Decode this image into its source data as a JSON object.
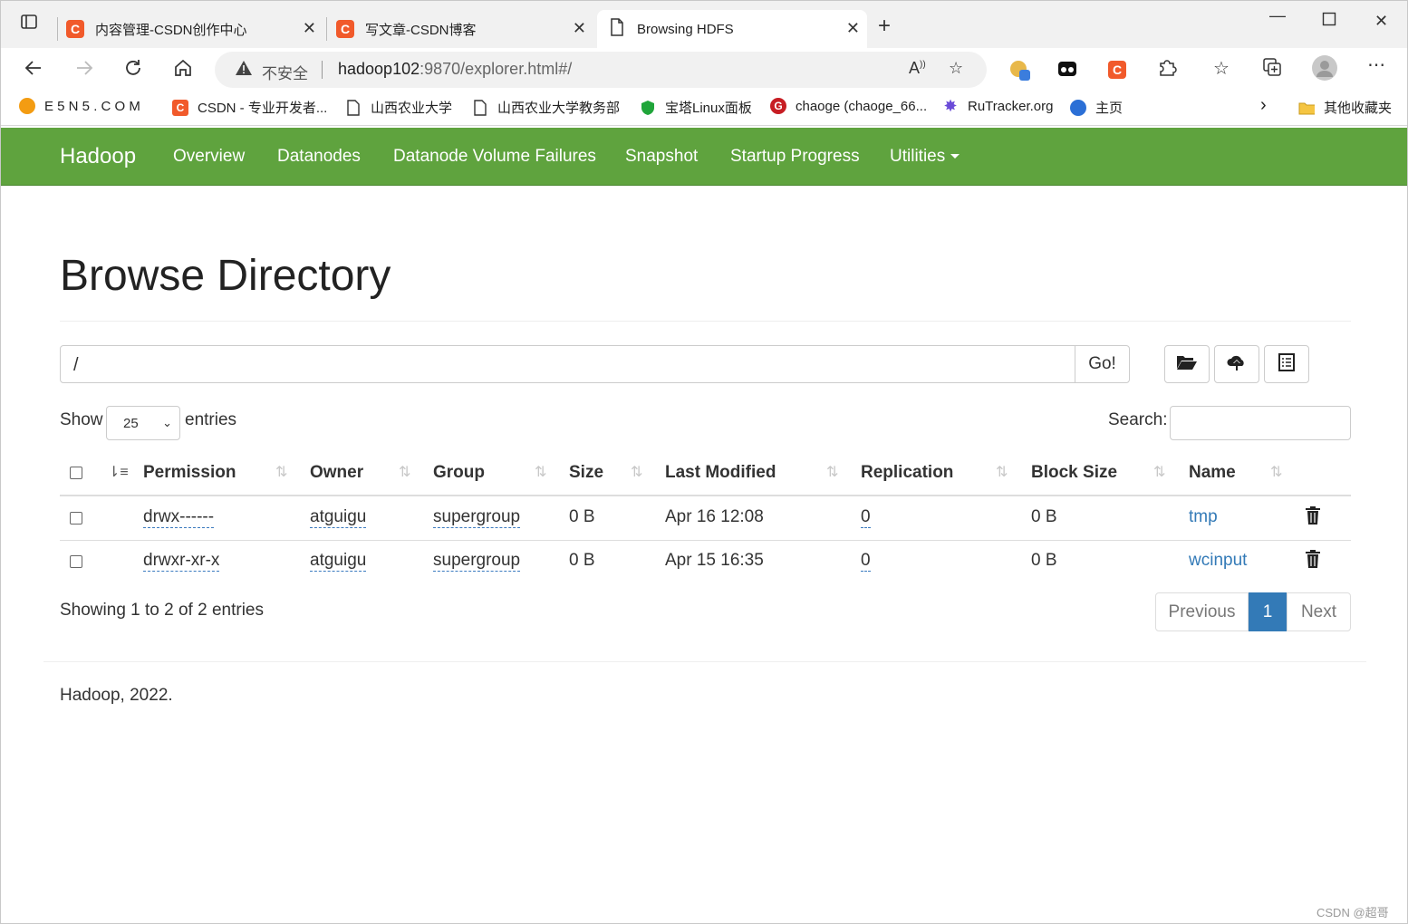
{
  "browser": {
    "tabs": [
      {
        "title": "内容管理-CSDN创作中心",
        "favicon": "C"
      },
      {
        "title": "写文章-CSDN博客",
        "favicon": "C"
      },
      {
        "title": "Browsing HDFS"
      }
    ],
    "address": {
      "security_label": "不安全",
      "url_host": "hadoop102",
      "url_rest": ":9870/explorer.html#/"
    },
    "bookmarks": [
      {
        "label": "E 5 N 5 . C O M",
        "icon": "e5n5-icon",
        "color": "#f39c12"
      },
      {
        "label": "CSDN - 专业开发者...",
        "icon": "csdn-icon",
        "color": "#f15a2b"
      },
      {
        "label": "山西农业大学",
        "icon": "page-icon"
      },
      {
        "label": "山西农业大学教务部",
        "icon": "page-icon"
      },
      {
        "label": "宝塔Linux面板",
        "icon": "shield-icon",
        "color": "#20a53a"
      },
      {
        "label": "chaoge (chaoge_66...",
        "icon": "gitee-icon",
        "color": "#c71d23"
      },
      {
        "label": "RuTracker.org",
        "icon": "star-icon",
        "color": "#6a4bd8"
      },
      {
        "label": "主页",
        "icon": "home-drop-icon",
        "color": "#2b6fd6"
      },
      {
        "label": "其他收藏夹",
        "icon": "folder-icon",
        "color": "#f5c542"
      }
    ]
  },
  "navbar": {
    "brand": "Hadoop",
    "links": [
      "Overview",
      "Datanodes",
      "Datanode Volume Failures",
      "Snapshot",
      "Startup Progress",
      "Utilities"
    ],
    "color": "#5fa33e"
  },
  "page": {
    "title": "Browse Directory",
    "path_value": "/",
    "go_label": "Go!",
    "show_label": "Show",
    "page_size": "25",
    "entries_label": "entries",
    "search_label": "Search:",
    "columns": [
      "Permission",
      "Owner",
      "Group",
      "Size",
      "Last Modified",
      "Replication",
      "Block Size",
      "Name"
    ],
    "rows": [
      {
        "permission": "drwx------",
        "owner": "atguigu",
        "group": "supergroup",
        "size": "0 B",
        "modified": "Apr 16 12:08",
        "replication": "0",
        "block_size": "0 B",
        "name": "tmp"
      },
      {
        "permission": "drwxr-xr-x",
        "owner": "atguigu",
        "group": "supergroup",
        "size": "0 B",
        "modified": "Apr 15 16:35",
        "replication": "0",
        "block_size": "0 B",
        "name": "wcinput"
      }
    ],
    "info": "Showing 1 to 2 of 2 entries",
    "pagination": {
      "previous": "Previous",
      "current": "1",
      "next": "Next"
    },
    "footer": "Hadoop, 2022."
  },
  "watermark": "CSDN @超哥"
}
